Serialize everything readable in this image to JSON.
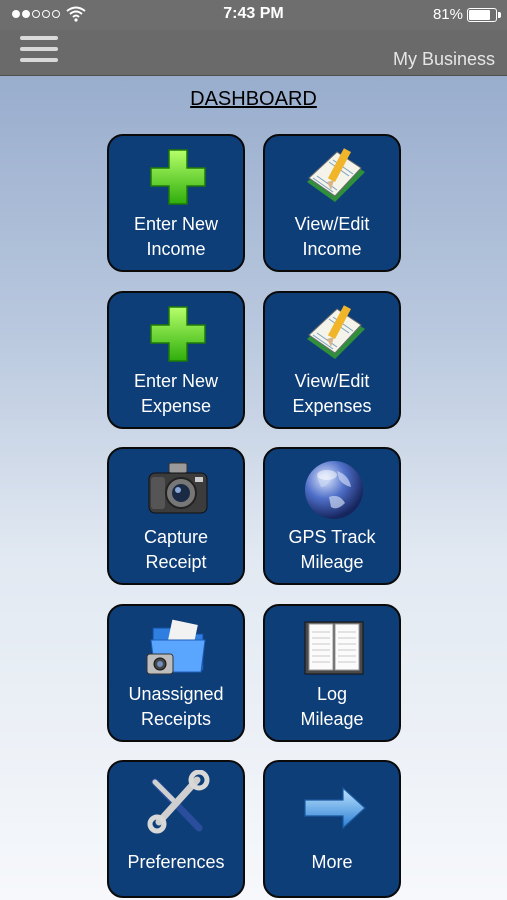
{
  "status": {
    "time": "7:43 PM",
    "battery": "81%",
    "battery_level": 0.81
  },
  "nav": {
    "title": "My Business",
    "menu_icon": "hamburger-menu-icon"
  },
  "dashboard": {
    "title": "DASHBOARD",
    "tiles": [
      {
        "label": "Enter New\nIncome",
        "icon": "plus-icon"
      },
      {
        "label": "View/Edit\nIncome",
        "icon": "notebook-pencil-icon"
      },
      {
        "label": "Enter New\nExpense",
        "icon": "plus-icon"
      },
      {
        "label": "View/Edit\nExpenses",
        "icon": "notebook-pencil-icon"
      },
      {
        "label": "Capture\nReceipt",
        "icon": "camera-icon"
      },
      {
        "label": "GPS Track\nMileage",
        "icon": "globe-icon"
      },
      {
        "label": "Unassigned\nReceipts",
        "icon": "folder-camera-icon"
      },
      {
        "label": "Log\nMileage",
        "icon": "open-book-icon"
      },
      {
        "label": "Preferences",
        "icon": "tools-icon"
      },
      {
        "label": "More",
        "icon": "arrow-right-icon"
      }
    ]
  }
}
